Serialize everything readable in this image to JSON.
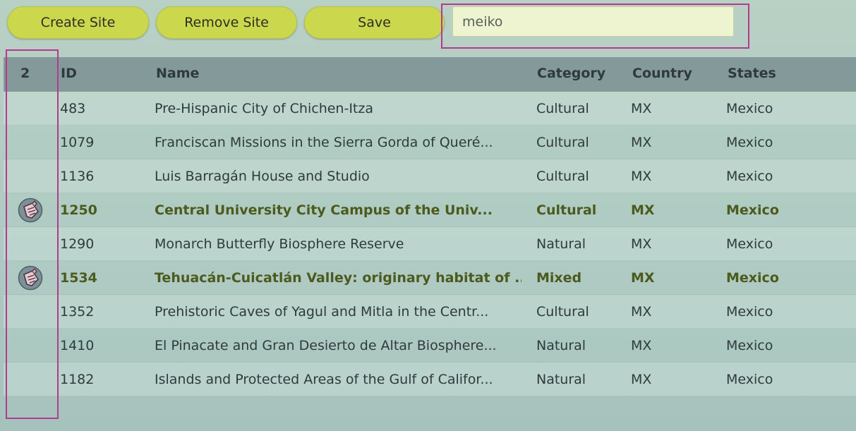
{
  "toolbar": {
    "create_label": "Create Site",
    "remove_label": "Remove Site",
    "save_label": "Save"
  },
  "search": {
    "value": "meiko"
  },
  "table": {
    "headers": {
      "selection_count": "2",
      "id": "ID",
      "name": "Name",
      "category": "Category",
      "country": "Country",
      "states": "States"
    },
    "rows": [
      {
        "id": "483",
        "name": "Pre-Hispanic City of Chichen-Itza",
        "category": "Cultural",
        "country": "MX",
        "states": "Mexico",
        "marked": false
      },
      {
        "id": "1079",
        "name": "Franciscan Missions in the Sierra Gorda of Queré...",
        "category": "Cultural",
        "country": "MX",
        "states": "Mexico",
        "marked": false
      },
      {
        "id": "1136",
        "name": "Luis Barragán House and Studio",
        "category": "Cultural",
        "country": "MX",
        "states": "Mexico",
        "marked": false
      },
      {
        "id": "1250",
        "name": "Central University City Campus of the Univ...",
        "category": "Cultural",
        "country": "MX",
        "states": "Mexico",
        "marked": true
      },
      {
        "id": "1290",
        "name": "Monarch Butterfly Biosphere Reserve",
        "category": "Natural",
        "country": "MX",
        "states": "Mexico",
        "marked": false
      },
      {
        "id": "1534",
        "name": "Tehuacán-Cuicatlán Valley: originary habitat of ...",
        "category": "Mixed",
        "country": "MX",
        "states": "Mexico",
        "marked": true
      },
      {
        "id": "1352",
        "name": "Prehistoric Caves of Yagul and Mitla in the Centr...",
        "category": "Cultural",
        "country": "MX",
        "states": "Mexico",
        "marked": false
      },
      {
        "id": "1410",
        "name": "El Pinacate and Gran Desierto de Altar Biosphere...",
        "category": "Natural",
        "country": "MX",
        "states": "Mexico",
        "marked": false
      },
      {
        "id": "1182",
        "name": "Islands and Protected Areas of the Gulf of Califor...",
        "category": "Natural",
        "country": "MX",
        "states": "Mexico",
        "marked": false
      }
    ]
  },
  "colors": {
    "button": "#cbd84e",
    "header": "#84999a",
    "highlight_outline": "#b43a8c",
    "selected_text": "#4d5a1e"
  },
  "icons": {
    "row_marker": "hand-pointer-icon"
  }
}
